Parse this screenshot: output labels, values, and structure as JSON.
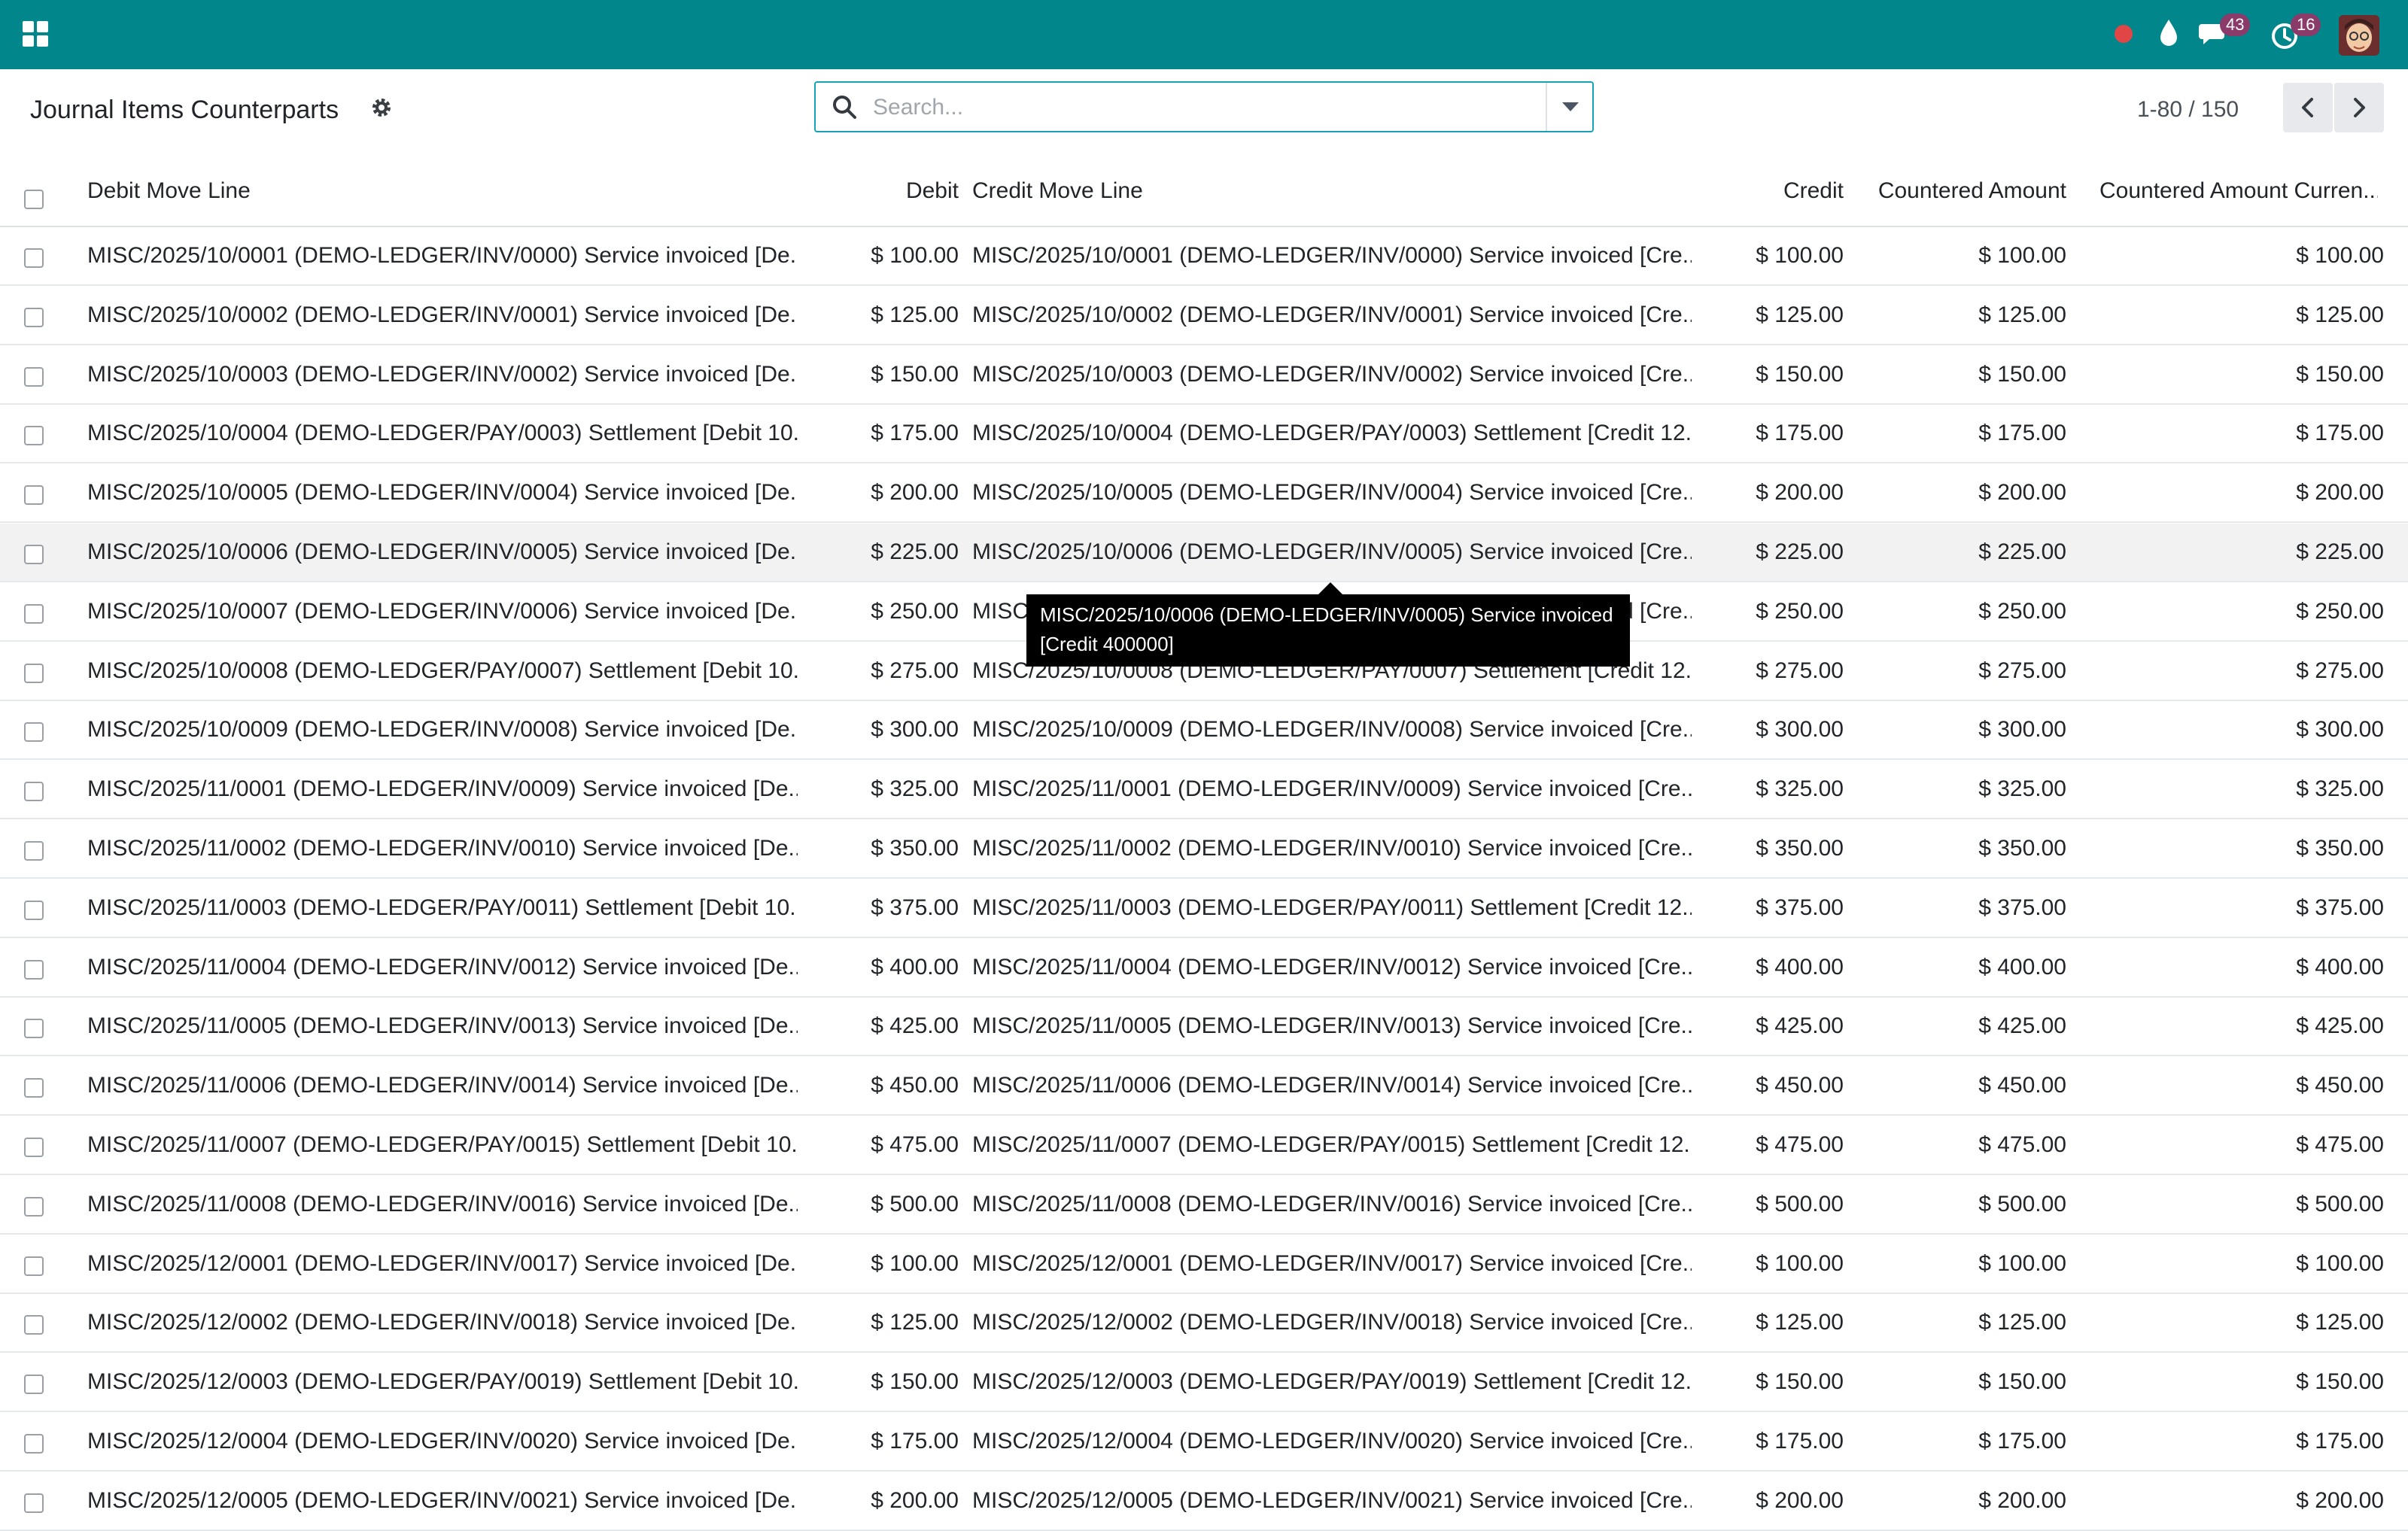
{
  "navbar": {
    "apps_icon": "grid-icon",
    "recording_color": "#e04646",
    "messages_badge": "43",
    "activities_badge": "16",
    "icons": [
      "record-dot-icon",
      "drop-icon",
      "chat-icon",
      "clock-icon",
      "avatar"
    ]
  },
  "control_panel": {
    "title": "Journal Items Counterparts",
    "search_placeholder": "Search...",
    "pager_value": "1-80 / 150"
  },
  "table": {
    "columns": {
      "debit_move_line": "Debit Move Line",
      "debit": "Debit",
      "credit_move_line": "Credit Move Line",
      "credit": "Credit",
      "countered_amount": "Countered Amount",
      "countered_amount_currency": "Countered Amount Curren..."
    },
    "rows": [
      {
        "debit_line": "MISC/2025/10/0001 (DEMO-LEDGER/INV/0000) Service invoiced [De...",
        "debit": "$ 100.00",
        "credit_line": "MISC/2025/10/0001 (DEMO-LEDGER/INV/0000) Service invoiced [Cre...",
        "credit": "$ 100.00",
        "countered": "$ 100.00",
        "countered_cur": "$ 100.00"
      },
      {
        "debit_line": "MISC/2025/10/0002 (DEMO-LEDGER/INV/0001) Service invoiced [De...",
        "debit": "$ 125.00",
        "credit_line": "MISC/2025/10/0002 (DEMO-LEDGER/INV/0001) Service invoiced [Cre...",
        "credit": "$ 125.00",
        "countered": "$ 125.00",
        "countered_cur": "$ 125.00"
      },
      {
        "debit_line": "MISC/2025/10/0003 (DEMO-LEDGER/INV/0002) Service invoiced [De...",
        "debit": "$ 150.00",
        "credit_line": "MISC/2025/10/0003 (DEMO-LEDGER/INV/0002) Service invoiced [Cre...",
        "credit": "$ 150.00",
        "countered": "$ 150.00",
        "countered_cur": "$ 150.00"
      },
      {
        "debit_line": "MISC/2025/10/0004 (DEMO-LEDGER/PAY/0003) Settlement [Debit 10...",
        "debit": "$ 175.00",
        "credit_line": "MISC/2025/10/0004 (DEMO-LEDGER/PAY/0003) Settlement [Credit 12...",
        "credit": "$ 175.00",
        "countered": "$ 175.00",
        "countered_cur": "$ 175.00"
      },
      {
        "debit_line": "MISC/2025/10/0005 (DEMO-LEDGER/INV/0004) Service invoiced [De...",
        "debit": "$ 200.00",
        "credit_line": "MISC/2025/10/0005 (DEMO-LEDGER/INV/0004) Service invoiced [Cre...",
        "credit": "$ 200.00",
        "countered": "$ 200.00",
        "countered_cur": "$ 200.00"
      },
      {
        "debit_line": "MISC/2025/10/0006 (DEMO-LEDGER/INV/0005) Service invoiced [De...",
        "debit": "$ 225.00",
        "credit_line": "MISC/2025/10/0006 (DEMO-LEDGER/INV/0005) Service invoiced [Cre...",
        "credit": "$ 225.00",
        "countered": "$ 225.00",
        "countered_cur": "$ 225.00"
      },
      {
        "debit_line": "MISC/2025/10/0007 (DEMO-LEDGER/INV/0006) Service invoiced [De...",
        "debit": "$ 250.00",
        "credit_line": "MISC/2025/10/0007 (DEMO-LEDGER/INV/0006) Service invoiced [Cre...",
        "credit": "$ 250.00",
        "countered": "$ 250.00",
        "countered_cur": "$ 250.00"
      },
      {
        "debit_line": "MISC/2025/10/0008 (DEMO-LEDGER/PAY/0007) Settlement [Debit 10...",
        "debit": "$ 275.00",
        "credit_line": "MISC/2025/10/0008 (DEMO-LEDGER/PAY/0007) Settlement [Credit 12...",
        "credit": "$ 275.00",
        "countered": "$ 275.00",
        "countered_cur": "$ 275.00"
      },
      {
        "debit_line": "MISC/2025/10/0009 (DEMO-LEDGER/INV/0008) Service invoiced [De...",
        "debit": "$ 300.00",
        "credit_line": "MISC/2025/10/0009 (DEMO-LEDGER/INV/0008) Service invoiced [Cre...",
        "credit": "$ 300.00",
        "countered": "$ 300.00",
        "countered_cur": "$ 300.00"
      },
      {
        "debit_line": "MISC/2025/11/0001 (DEMO-LEDGER/INV/0009) Service invoiced [De...",
        "debit": "$ 325.00",
        "credit_line": "MISC/2025/11/0001 (DEMO-LEDGER/INV/0009) Service invoiced [Cre...",
        "credit": "$ 325.00",
        "countered": "$ 325.00",
        "countered_cur": "$ 325.00"
      },
      {
        "debit_line": "MISC/2025/11/0002 (DEMO-LEDGER/INV/0010) Service invoiced [De...",
        "debit": "$ 350.00",
        "credit_line": "MISC/2025/11/0002 (DEMO-LEDGER/INV/0010) Service invoiced [Cre...",
        "credit": "$ 350.00",
        "countered": "$ 350.00",
        "countered_cur": "$ 350.00"
      },
      {
        "debit_line": "MISC/2025/11/0003 (DEMO-LEDGER/PAY/0011) Settlement [Debit 10...",
        "debit": "$ 375.00",
        "credit_line": "MISC/2025/11/0003 (DEMO-LEDGER/PAY/0011) Settlement [Credit 12...",
        "credit": "$ 375.00",
        "countered": "$ 375.00",
        "countered_cur": "$ 375.00"
      },
      {
        "debit_line": "MISC/2025/11/0004 (DEMO-LEDGER/INV/0012) Service invoiced [De...",
        "debit": "$ 400.00",
        "credit_line": "MISC/2025/11/0004 (DEMO-LEDGER/INV/0012) Service invoiced [Cre...",
        "credit": "$ 400.00",
        "countered": "$ 400.00",
        "countered_cur": "$ 400.00"
      },
      {
        "debit_line": "MISC/2025/11/0005 (DEMO-LEDGER/INV/0013) Service invoiced [De...",
        "debit": "$ 425.00",
        "credit_line": "MISC/2025/11/0005 (DEMO-LEDGER/INV/0013) Service invoiced [Cre...",
        "credit": "$ 425.00",
        "countered": "$ 425.00",
        "countered_cur": "$ 425.00"
      },
      {
        "debit_line": "MISC/2025/11/0006 (DEMO-LEDGER/INV/0014) Service invoiced [De...",
        "debit": "$ 450.00",
        "credit_line": "MISC/2025/11/0006 (DEMO-LEDGER/INV/0014) Service invoiced [Cre...",
        "credit": "$ 450.00",
        "countered": "$ 450.00",
        "countered_cur": "$ 450.00"
      },
      {
        "debit_line": "MISC/2025/11/0007 (DEMO-LEDGER/PAY/0015) Settlement [Debit 10...",
        "debit": "$ 475.00",
        "credit_line": "MISC/2025/11/0007 (DEMO-LEDGER/PAY/0015) Settlement [Credit 12...",
        "credit": "$ 475.00",
        "countered": "$ 475.00",
        "countered_cur": "$ 475.00"
      },
      {
        "debit_line": "MISC/2025/11/0008 (DEMO-LEDGER/INV/0016) Service invoiced [De...",
        "debit": "$ 500.00",
        "credit_line": "MISC/2025/11/0008 (DEMO-LEDGER/INV/0016) Service invoiced [Cre...",
        "credit": "$ 500.00",
        "countered": "$ 500.00",
        "countered_cur": "$ 500.00"
      },
      {
        "debit_line": "MISC/2025/12/0001 (DEMO-LEDGER/INV/0017) Service invoiced [De...",
        "debit": "$ 100.00",
        "credit_line": "MISC/2025/12/0001 (DEMO-LEDGER/INV/0017) Service invoiced [Cre...",
        "credit": "$ 100.00",
        "countered": "$ 100.00",
        "countered_cur": "$ 100.00"
      },
      {
        "debit_line": "MISC/2025/12/0002 (DEMO-LEDGER/INV/0018) Service invoiced [De...",
        "debit": "$ 125.00",
        "credit_line": "MISC/2025/12/0002 (DEMO-LEDGER/INV/0018) Service invoiced [Cre...",
        "credit": "$ 125.00",
        "countered": "$ 125.00",
        "countered_cur": "$ 125.00"
      },
      {
        "debit_line": "MISC/2025/12/0003 (DEMO-LEDGER/PAY/0019) Settlement [Debit 10...",
        "debit": "$ 150.00",
        "credit_line": "MISC/2025/12/0003 (DEMO-LEDGER/PAY/0019) Settlement [Credit 12...",
        "credit": "$ 150.00",
        "countered": "$ 150.00",
        "countered_cur": "$ 150.00"
      },
      {
        "debit_line": "MISC/2025/12/0004 (DEMO-LEDGER/INV/0020) Service invoiced [De...",
        "debit": "$ 175.00",
        "credit_line": "MISC/2025/12/0004 (DEMO-LEDGER/INV/0020) Service invoiced [Cre...",
        "credit": "$ 175.00",
        "countered": "$ 175.00",
        "countered_cur": "$ 175.00"
      },
      {
        "debit_line": "MISC/2025/12/0005 (DEMO-LEDGER/INV/0021) Service invoiced [De...",
        "debit": "$ 200.00",
        "credit_line": "MISC/2025/12/0005 (DEMO-LEDGER/INV/0021) Service invoiced [Cre...",
        "credit": "$ 200.00",
        "countered": "$ 200.00",
        "countered_cur": "$ 200.00"
      }
    ],
    "hovered_row_index": 5
  },
  "tooltip": {
    "line1": "MISC/2025/10/0006 (DEMO-LEDGER/INV/0005) Service invoiced",
    "line2": "[Credit 400000]"
  }
}
